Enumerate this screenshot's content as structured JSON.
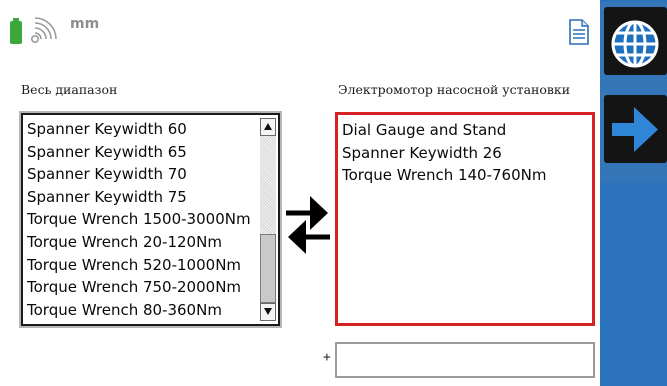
{
  "status_bar": {
    "battery_icon": "battery-icon",
    "battery_color": "#3da83b",
    "signal_icon": "wireless-signal-icon",
    "units_label": "mm",
    "doc_icon": "document-icon"
  },
  "left_panel": {
    "label": "Весь диапазон",
    "items": [
      "Spanner Keywidth 60",
      "Spanner Keywidth 65",
      "Spanner Keywidth 70",
      "Spanner Keywidth 75",
      "Torque Wrench 1500-3000Nm",
      "Torque Wrench 20-120Nm",
      "Torque Wrench 520-1000Nm",
      "Torque Wrench 750-2000Nm",
      "Torque Wrench 80-360Nm"
    ]
  },
  "right_panel": {
    "label": "Электромотор насосной установки",
    "items": [
      "Dial Gauge and Stand",
      "Spanner Keywidth 26",
      "Torque Wrench 140-760Nm"
    ],
    "border_color": "#d42121"
  },
  "transfer": {
    "icon": "transfer-arrows-icon"
  },
  "add_row": {
    "plus_label": "+",
    "input_value": ""
  },
  "sidebar": {
    "color": "#2b74bc",
    "buttons": [
      {
        "icon": "globe-icon"
      },
      {
        "icon": "arrow-right-icon"
      }
    ]
  }
}
